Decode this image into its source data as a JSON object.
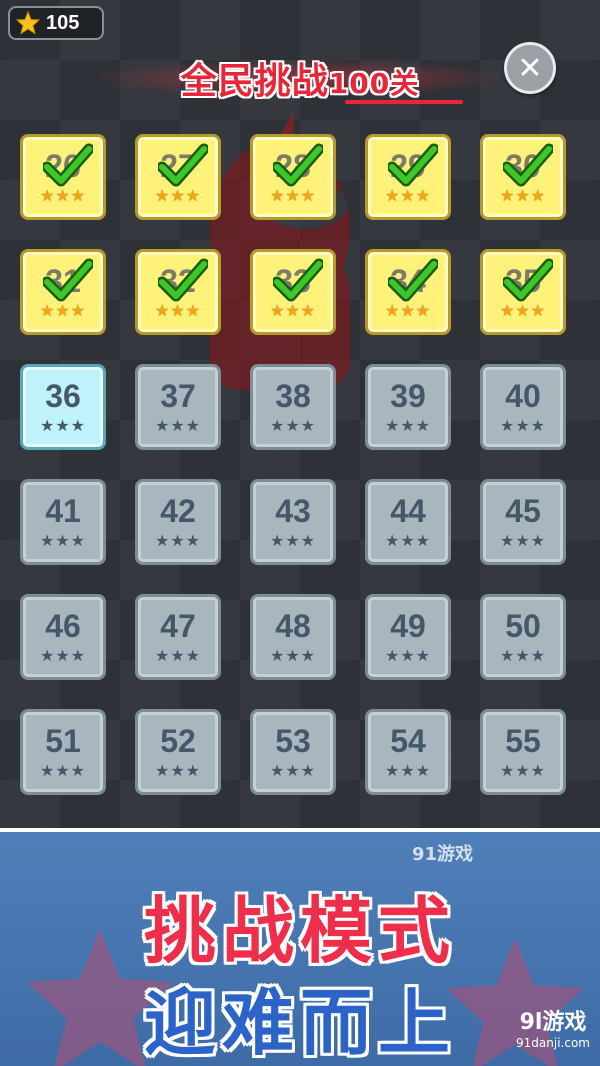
{
  "header": {
    "star_count": "105",
    "title": "全民挑战",
    "title_number": "100关",
    "close_symbol": "✕"
  },
  "levels": [
    {
      "number": "26",
      "status": "completed",
      "stars": 3
    },
    {
      "number": "27",
      "status": "completed",
      "stars": 3
    },
    {
      "number": "28",
      "status": "completed",
      "stars": 3
    },
    {
      "number": "29",
      "status": "completed",
      "stars": 3
    },
    {
      "number": "30",
      "status": "completed",
      "stars": 3
    },
    {
      "number": "31",
      "status": "completed",
      "stars": 3
    },
    {
      "number": "32",
      "status": "completed",
      "stars": 3
    },
    {
      "number": "33",
      "status": "completed",
      "stars": 3
    },
    {
      "number": "34",
      "status": "completed",
      "stars": 3
    },
    {
      "number": "35",
      "status": "completed",
      "stars": 3
    },
    {
      "number": "36",
      "status": "current",
      "stars": 0
    },
    {
      "number": "37",
      "status": "locked",
      "stars": 0
    },
    {
      "number": "38",
      "status": "locked",
      "stars": 0
    },
    {
      "number": "39",
      "status": "locked",
      "stars": 0
    },
    {
      "number": "40",
      "status": "locked",
      "stars": 0
    },
    {
      "number": "41",
      "status": "locked",
      "stars": 0
    },
    {
      "number": "42",
      "status": "locked",
      "stars": 0
    },
    {
      "number": "43",
      "status": "locked",
      "stars": 0
    },
    {
      "number": "44",
      "status": "locked",
      "stars": 0
    },
    {
      "number": "45",
      "status": "locked",
      "stars": 0
    },
    {
      "number": "46",
      "status": "locked",
      "stars": 0
    },
    {
      "number": "47",
      "status": "locked",
      "stars": 0
    },
    {
      "number": "48",
      "status": "locked",
      "stars": 0
    },
    {
      "number": "49",
      "status": "locked",
      "stars": 0
    },
    {
      "number": "50",
      "status": "locked",
      "stars": 0
    },
    {
      "number": "51",
      "status": "locked",
      "stars": 0
    },
    {
      "number": "52",
      "status": "locked",
      "stars": 0
    },
    {
      "number": "53",
      "status": "locked",
      "stars": 0
    },
    {
      "number": "54",
      "status": "locked",
      "stars": 0
    },
    {
      "number": "55",
      "status": "locked",
      "stars": 0
    }
  ],
  "banner": {
    "line1": "挑战模式",
    "line2": "迎难而上",
    "watermark_mid": "91游戏",
    "watermark_brand": "9l游戏",
    "watermark_url": "91danji.com"
  },
  "colors": {
    "completed_tile": "#fff27a",
    "current_tile": "#bff2fa",
    "locked_tile": "#a9b6bd",
    "title_red": "#e8263a",
    "banner_blue": "#4f7fb8"
  }
}
